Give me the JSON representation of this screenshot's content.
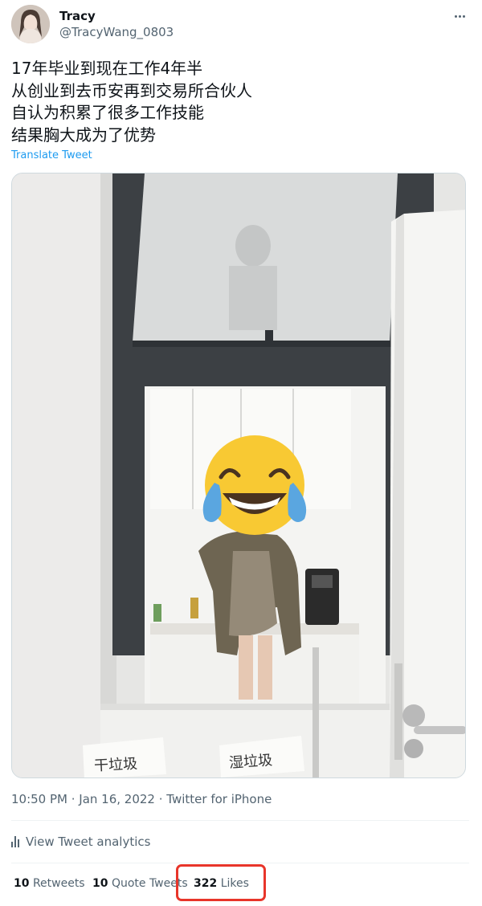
{
  "author": {
    "name": "Tracy",
    "handle": "@TracyWang_0803"
  },
  "tweet": {
    "lines": [
      "17年毕业到现在工作4年半",
      "从创业到去币安再到交易所合伙人",
      "自认为积累了很多工作技能",
      "结果胸大成为了优势"
    ],
    "translate_label": "Translate Tweet"
  },
  "photo": {
    "sign_left": "干垃圾",
    "sign_right": "湿垃圾",
    "face_emoji": "face-with-tears-of-joy-emoji"
  },
  "meta": {
    "timestamp": "10:50 PM · Jan 16, 2022 · Twitter for iPhone"
  },
  "analytics": {
    "label": "View Tweet analytics"
  },
  "stats": {
    "retweets_count": "10",
    "retweets_label": "Retweets",
    "quotes_count": "10",
    "quotes_label": "Quote Tweets",
    "likes_count": "322",
    "likes_label": "Likes"
  },
  "colors": {
    "link": "#1d9bf0",
    "secondary_text": "#536471",
    "highlight_box": "#e8352a"
  }
}
